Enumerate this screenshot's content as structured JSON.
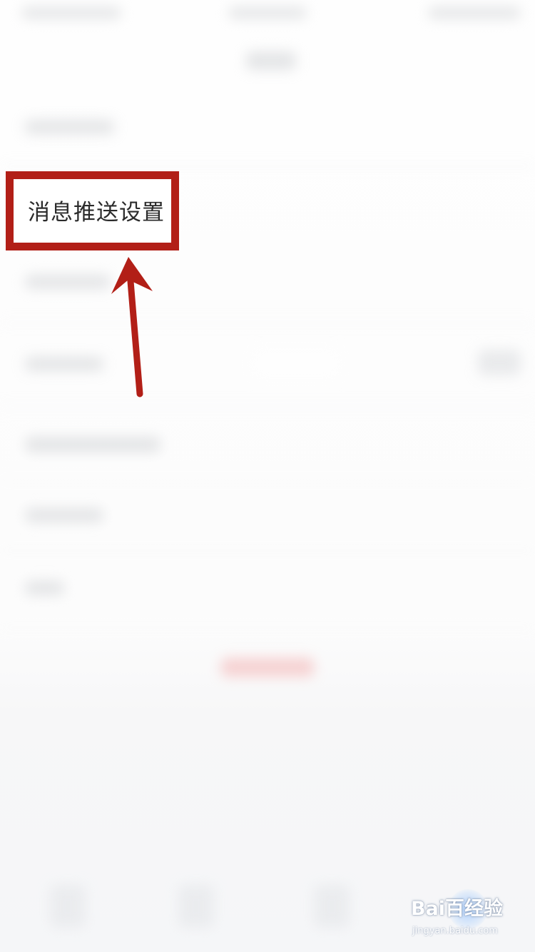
{
  "settings_page": {
    "highlighted_item": {
      "label": "消息推送设置"
    }
  },
  "annotation": {
    "box_color": "#b21f17",
    "arrow_color": "#b21f17",
    "arrow_direction": "up"
  },
  "watermark": {
    "logo_text": "Bai百经验",
    "sub_text": "jingyan.baidu.com"
  }
}
